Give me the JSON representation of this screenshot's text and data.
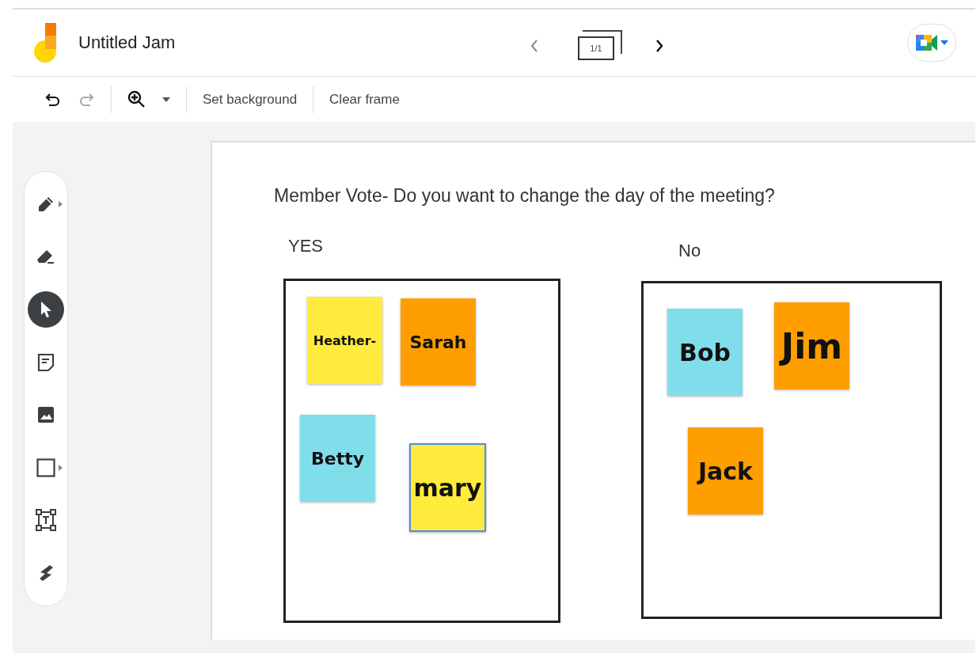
{
  "app": {
    "title": "Untitled Jam"
  },
  "frame_nav": {
    "counter": "1/1"
  },
  "toolbar": {
    "undo_disabled": false,
    "redo_disabled": true,
    "buttons": [
      "Set background",
      "Clear frame"
    ]
  },
  "tools": [
    {
      "kind": "pen",
      "selected": false,
      "submenu": true
    },
    {
      "kind": "eraser",
      "selected": false,
      "submenu": false
    },
    {
      "kind": "select",
      "selected": true,
      "submenu": false
    },
    {
      "kind": "note",
      "selected": false,
      "submenu": false
    },
    {
      "kind": "image",
      "selected": false,
      "submenu": false
    },
    {
      "kind": "shape",
      "selected": false,
      "submenu": true
    },
    {
      "kind": "textbox",
      "selected": false,
      "submenu": false
    },
    {
      "kind": "laser",
      "selected": false,
      "submenu": false
    }
  ],
  "canvas": {
    "question": "Member Vote- Do you want to change the day of the meeting?",
    "columns": [
      {
        "label": "YES",
        "notes": [
          {
            "text": "Heather-",
            "color": "#ffeb3b",
            "selected": false
          },
          {
            "text": "Sarah",
            "color": "#ff9e00",
            "selected": false
          },
          {
            "text": "Betty",
            "color": "#80deea",
            "selected": false
          },
          {
            "text": "mary",
            "color": "#ffeb3b",
            "selected": true
          }
        ]
      },
      {
        "label": "No",
        "notes": [
          {
            "text": "Bob",
            "color": "#80deea",
            "selected": false
          },
          {
            "text": "Jim",
            "color": "#ff9e00",
            "selected": false
          },
          {
            "text": "Jack",
            "color": "#ff9e00",
            "selected": false
          }
        ]
      }
    ]
  }
}
